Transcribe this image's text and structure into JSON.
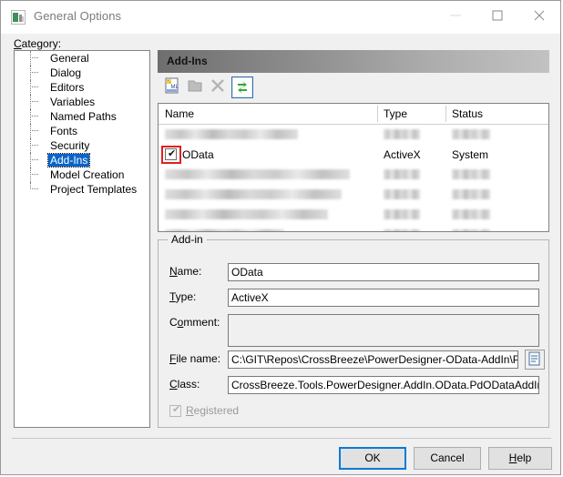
{
  "window": {
    "title": "General Options",
    "icon": "app-icon",
    "buttons": {
      "minimize": "minimize-icon",
      "maximize": "maximize-icon",
      "close": "close-icon"
    }
  },
  "category": {
    "label": "Category:",
    "accelerator": "C",
    "items": [
      {
        "label": "General",
        "selected": false
      },
      {
        "label": "Dialog",
        "selected": false
      },
      {
        "label": "Editors",
        "selected": false
      },
      {
        "label": "Variables",
        "selected": false
      },
      {
        "label": "Named Paths",
        "selected": false
      },
      {
        "label": "Fonts",
        "selected": false
      },
      {
        "label": "Security",
        "selected": false
      },
      {
        "label": "Add-Ins",
        "selected": true
      },
      {
        "label": "Model Creation",
        "selected": false
      },
      {
        "label": "Project Templates",
        "selected": false
      }
    ]
  },
  "panel": {
    "header": "Add-Ins",
    "toolbar": [
      {
        "name": "add-xml-addin-icon",
        "enabled": true
      },
      {
        "name": "open-folder-icon",
        "enabled": false
      },
      {
        "name": "delete-icon",
        "enabled": false
      },
      {
        "name": "refresh-icon",
        "enabled": true
      }
    ],
    "list": {
      "columns": [
        "Name",
        "Type",
        "Status"
      ],
      "rows": [
        {
          "blurred": true,
          "checked": false,
          "name": "",
          "type": "",
          "status": "",
          "highlighted": false
        },
        {
          "blurred": false,
          "checked": true,
          "name": "OData",
          "type": "ActiveX",
          "status": "System",
          "highlighted": true
        },
        {
          "blurred": true,
          "checked": false,
          "name": "",
          "type": "",
          "status": "",
          "highlighted": false
        },
        {
          "blurred": true,
          "checked": false,
          "name": "",
          "type": "",
          "status": "",
          "highlighted": false
        },
        {
          "blurred": true,
          "checked": false,
          "name": "",
          "type": "",
          "status": "",
          "highlighted": false
        },
        {
          "blurred": true,
          "checked": false,
          "name": "",
          "type": "",
          "status": "",
          "highlighted": false
        }
      ]
    }
  },
  "addin": {
    "legend": "Add-in",
    "fields": {
      "name_label": "Name:",
      "name_value": "OData",
      "type_label": "Type:",
      "type_value": "ActiveX",
      "comment_label": "Comment:",
      "comment_value": "",
      "file_label": "File name:",
      "file_value": "C:\\GIT\\Repos\\CrossBreeze\\PowerDesigner-OData-AddIn\\Power",
      "browse_icon": "browse-file-icon",
      "class_label": "Class:",
      "class_value": "CrossBreeze.Tools.PowerDesigner.AddIn.OData.PdODataAddIn",
      "registered_label": "Registered",
      "registered_checked": true,
      "registered_enabled": false
    }
  },
  "footer": {
    "ok": "OK",
    "cancel": "Cancel",
    "help": "Help"
  },
  "colors": {
    "selection": "#0a64c8",
    "highlight_annotation": "#e02020",
    "default_button_focus": "#0a7ad8"
  }
}
